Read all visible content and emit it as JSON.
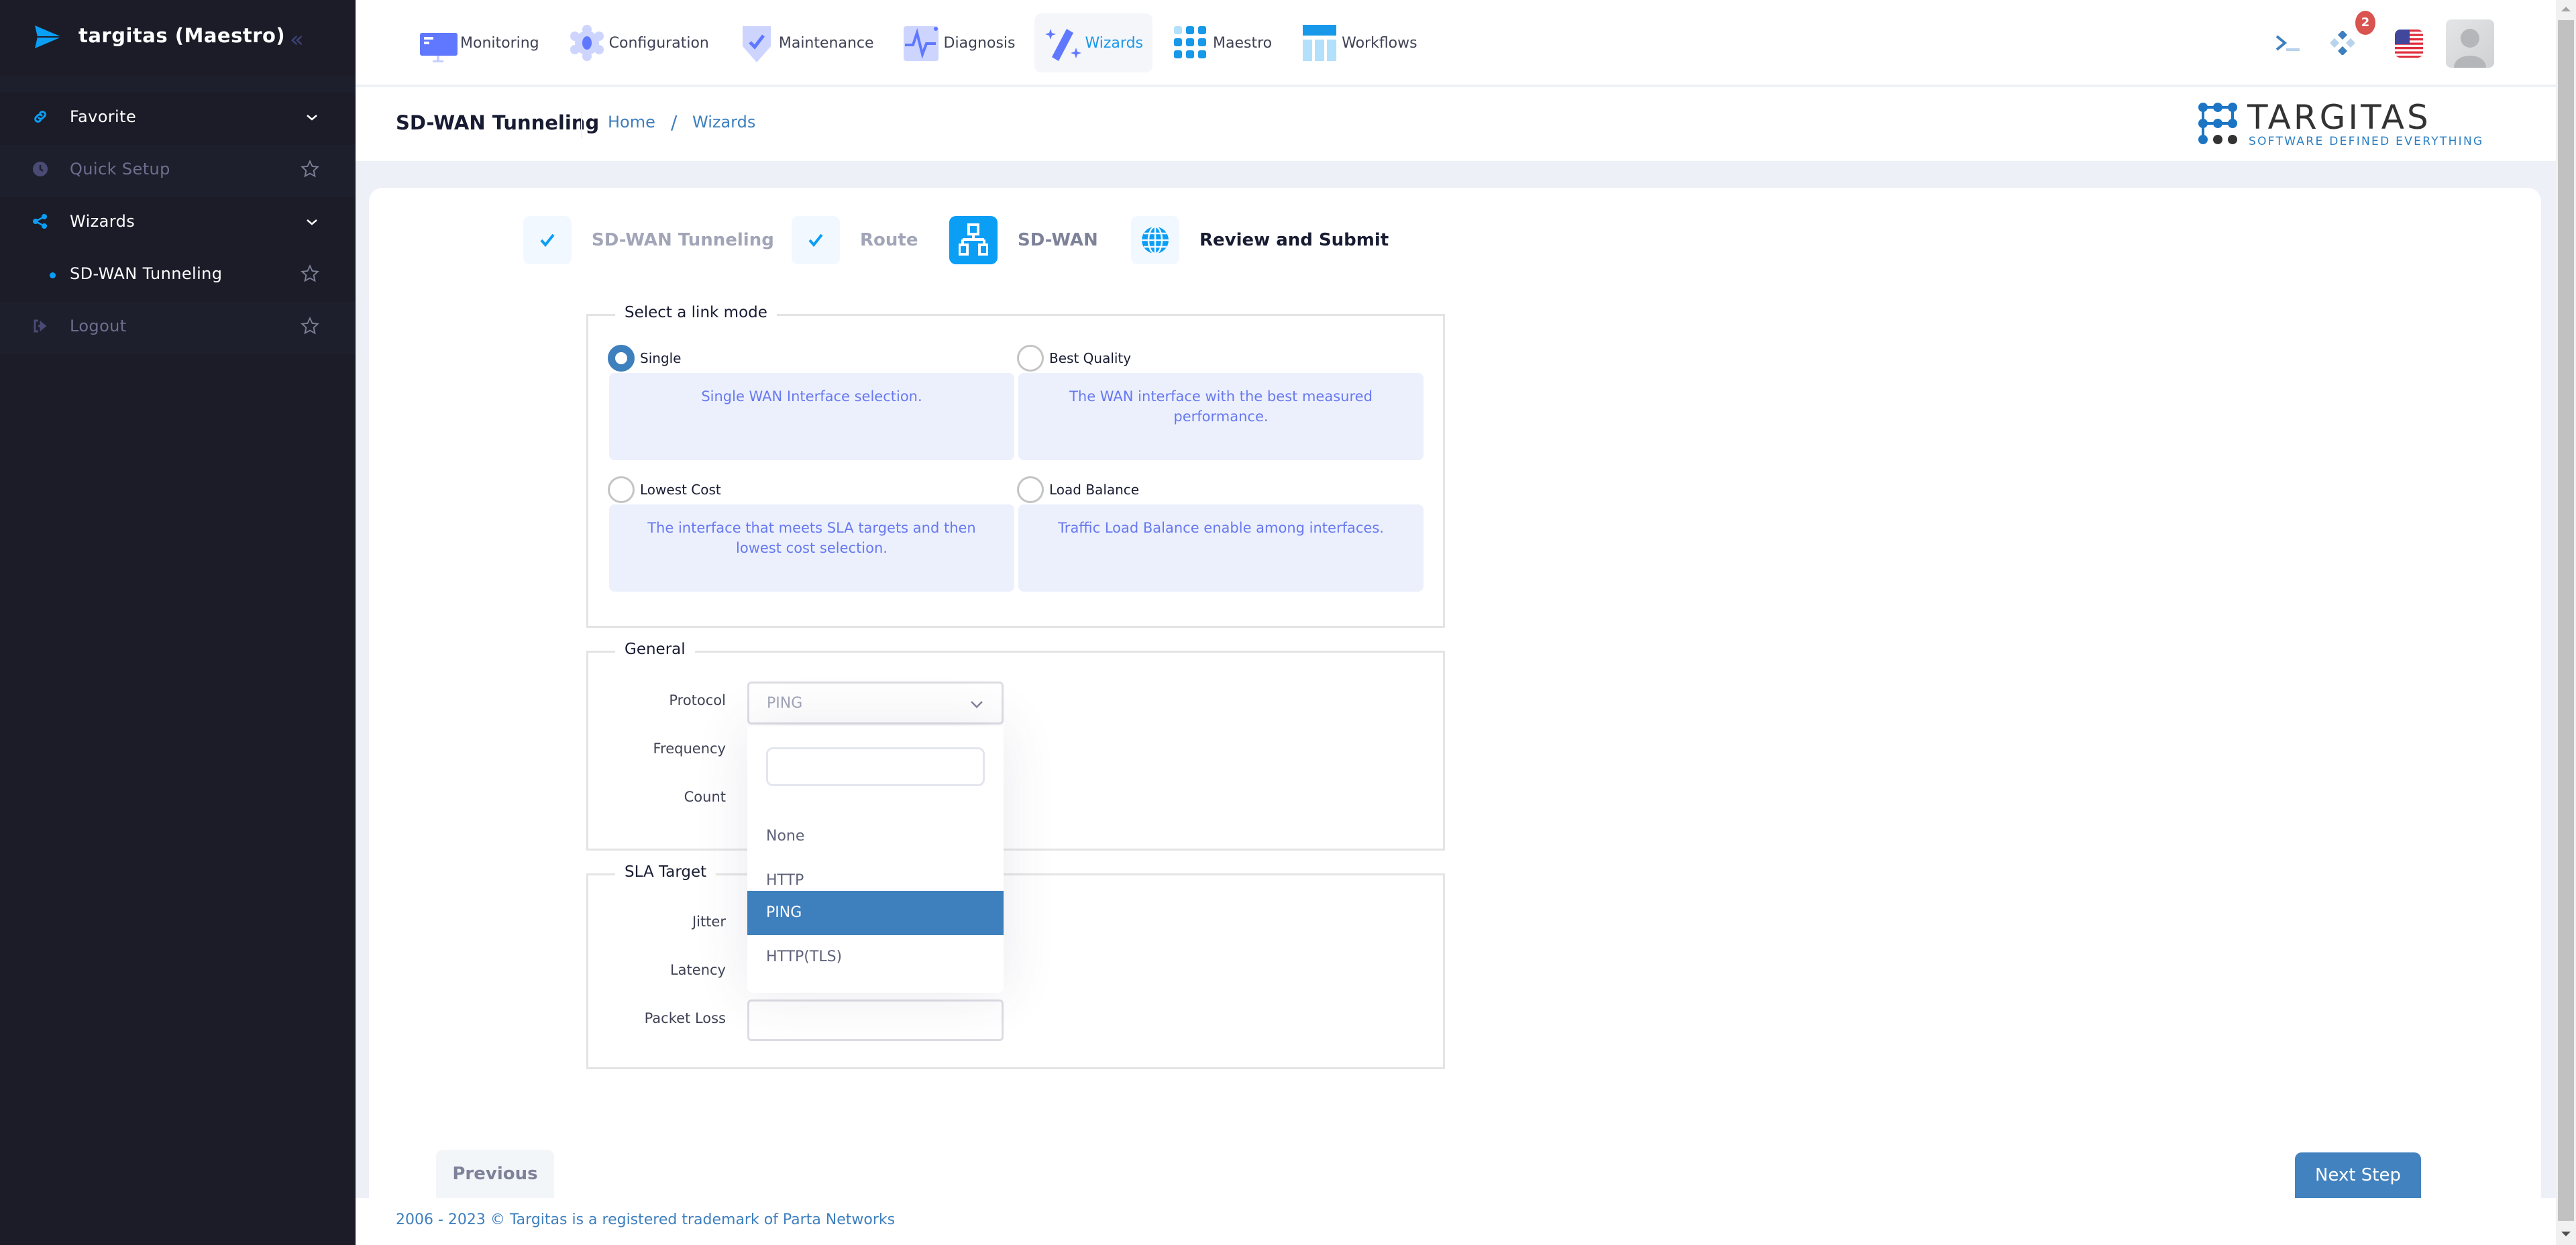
{
  "sidebar": {
    "app_title": "targitas (Maestro)",
    "items": [
      {
        "label": "Favorite",
        "icon": "link-icon",
        "trailing": "chevron-down"
      },
      {
        "label": "Quick Setup",
        "icon": "clock-icon",
        "trailing": "star"
      },
      {
        "label": "Wizards",
        "icon": "share-icon",
        "trailing": "chevron-down"
      },
      {
        "label": "SD-WAN Tunneling",
        "icon": "bullet",
        "trailing": "star"
      },
      {
        "label": "Logout",
        "icon": "logout-icon",
        "trailing": "star"
      }
    ]
  },
  "topnav": {
    "items": [
      {
        "label": "Monitoring",
        "icon": "monitor-icon"
      },
      {
        "label": "Configuration",
        "icon": "gear-icon"
      },
      {
        "label": "Maintenance",
        "icon": "shield-check-icon"
      },
      {
        "label": "Diagnosis",
        "icon": "pulse-icon"
      },
      {
        "label": "Wizards",
        "icon": "magic-wand-icon",
        "active": true
      },
      {
        "label": "Maestro",
        "icon": "grid-dots-icon"
      },
      {
        "label": "Workflows",
        "icon": "columns-icon"
      }
    ],
    "notifications_count": "2",
    "language": "en-US"
  },
  "header": {
    "page_title": "SD-WAN Tunneling",
    "breadcrumb": [
      "Home",
      "Wizards"
    ],
    "brand_name": "TARGITAS",
    "brand_tagline": "SOFTWARE DEFINED EVERYTHING"
  },
  "stepper": [
    {
      "label": "SD-WAN Tunneling",
      "state": "done"
    },
    {
      "label": "Route",
      "state": "done"
    },
    {
      "label": "SD-WAN",
      "state": "current"
    },
    {
      "label": "Review and Submit",
      "state": "upcoming"
    }
  ],
  "link_mode": {
    "legend": "Select a link mode",
    "selected": "Single",
    "options": [
      {
        "label": "Single",
        "description": "Single WAN Interface selection."
      },
      {
        "label": "Best Quality",
        "description": "The WAN interface with the best measured performance."
      },
      {
        "label": "Lowest Cost",
        "description": "The interface that meets SLA targets and then lowest cost selection."
      },
      {
        "label": "Load Balance",
        "description": "Traffic Load Balance enable among interfaces."
      }
    ]
  },
  "general": {
    "legend": "General",
    "protocol_label": "Protocol",
    "protocol_value": "PING",
    "frequency_label": "Frequency",
    "count_label": "Count",
    "dropdown": {
      "search_value": "",
      "options": [
        "None",
        "HTTP",
        "PING",
        "HTTP(TLS)"
      ],
      "highlighted": "PING"
    }
  },
  "sla": {
    "legend": "SLA Target",
    "jitter_label": "Jitter",
    "latency_label": "Latency",
    "packet_loss_label": "Packet Loss",
    "packet_loss_value": ""
  },
  "actions": {
    "previous": "Previous",
    "next": "Next Step"
  },
  "footer": {
    "text": "2006 - 2023 © Targitas is a registered trademark of Parta Networks"
  },
  "colors": {
    "sidebar_bg": "#1b1c28",
    "accent": "#0a9ef5",
    "primary": "#3e7fbe",
    "badge": "#d9534f"
  }
}
